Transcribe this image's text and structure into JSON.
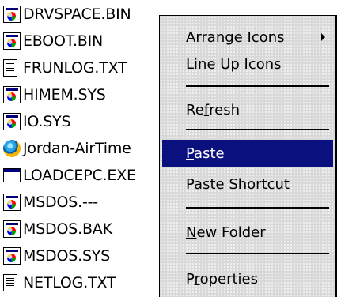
{
  "files": [
    {
      "name": "DRVSPACE.BIN",
      "icon": "sys-file-icon"
    },
    {
      "name": "EBOOT.BIN",
      "icon": "sys-file-icon"
    },
    {
      "name": "FRUNLOG.TXT",
      "icon": "text-file-icon"
    },
    {
      "name": "HIMEM.SYS",
      "icon": "sys-file-icon"
    },
    {
      "name": "IO.SYS",
      "icon": "sys-file-icon"
    },
    {
      "name": "Jordan-AirTime",
      "icon": "app-icon"
    },
    {
      "name": "LOADCEPC.EXE",
      "icon": "exe-file-icon"
    },
    {
      "name": "MSDOS.---",
      "icon": "sys-file-icon"
    },
    {
      "name": "MSDOS.BAK",
      "icon": "sys-file-icon"
    },
    {
      "name": "MSDOS.SYS",
      "icon": "sys-file-icon"
    },
    {
      "name": "NETLOG.TXT",
      "icon": "text-file-icon"
    }
  ],
  "menu": {
    "arrange_icons": {
      "pre": "Arrange ",
      "key": "I",
      "post": "cons"
    },
    "line_up_icons": {
      "pre": "Lin",
      "key": "e",
      "post": " Up Icons"
    },
    "refresh": {
      "pre": "Re",
      "key": "f",
      "post": "resh"
    },
    "paste": {
      "pre": "",
      "key": "P",
      "post": "aste"
    },
    "paste_shortcut": {
      "pre": "Paste ",
      "key": "S",
      "post": "hortcut"
    },
    "new_folder": {
      "pre": "",
      "key": "N",
      "post": "ew Folder"
    },
    "properties": {
      "pre": "P",
      "key": "r",
      "post": "operties"
    }
  },
  "colors": {
    "selection": "#0a107e",
    "menu_background": "#d9d9d9"
  }
}
